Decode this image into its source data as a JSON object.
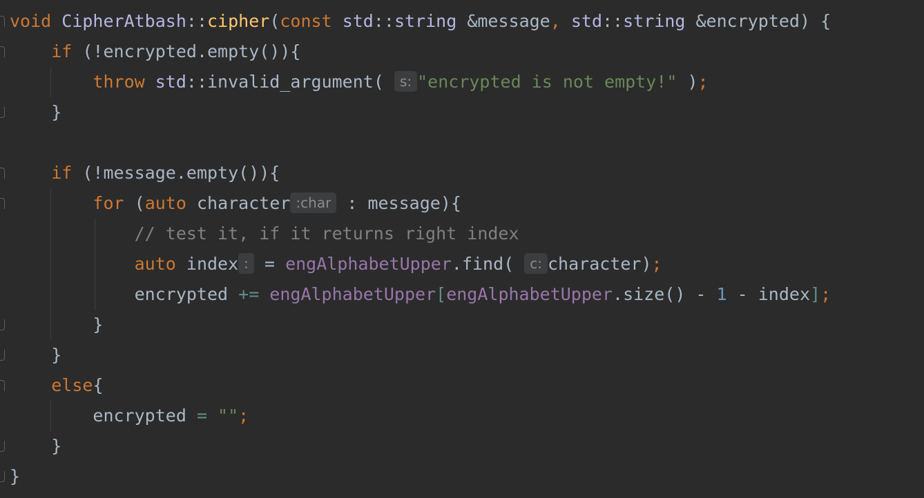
{
  "editor": {
    "language": "C++",
    "lines": [
      {
        "tokens": [
          {
            "t": "void ",
            "c": "kw"
          },
          {
            "t": "CipherAtbash",
            "c": "cls"
          },
          {
            "t": "::",
            "c": "plain"
          },
          {
            "t": "cipher",
            "c": "fn"
          },
          {
            "t": "(",
            "c": "plain"
          },
          {
            "t": "const ",
            "c": "kw"
          },
          {
            "t": "std",
            "c": "cls"
          },
          {
            "t": "::",
            "c": "plain"
          },
          {
            "t": "string ",
            "c": "cls"
          },
          {
            "t": "&message",
            "c": "plain"
          },
          {
            "t": ", ",
            "c": "kw"
          },
          {
            "t": "std",
            "c": "cls"
          },
          {
            "t": "::",
            "c": "plain"
          },
          {
            "t": "string ",
            "c": "cls"
          },
          {
            "t": "&encrypted) {",
            "c": "plain"
          }
        ]
      },
      {
        "tokens": [
          {
            "t": "    ",
            "c": "plain"
          },
          {
            "t": "if ",
            "c": "kw"
          },
          {
            "t": "(!encrypted.empty()){",
            "c": "plain"
          }
        ]
      },
      {
        "tokens": [
          {
            "t": "        ",
            "c": "plain"
          },
          {
            "t": "throw ",
            "c": "kw"
          },
          {
            "t": "std",
            "c": "cls"
          },
          {
            "t": "::",
            "c": "plain"
          },
          {
            "t": "invalid_argument( ",
            "c": "plain"
          },
          {
            "t": "s:",
            "c": "hint"
          },
          {
            "t": "\"encrypted is not empty!\"",
            "c": "str"
          },
          {
            "t": " )",
            "c": "plain"
          },
          {
            "t": ";",
            "c": "kw"
          }
        ]
      },
      {
        "tokens": [
          {
            "t": "    }",
            "c": "plain"
          }
        ]
      },
      {
        "tokens": [
          {
            "t": "",
            "c": "plain"
          }
        ]
      },
      {
        "tokens": [
          {
            "t": "    ",
            "c": "plain"
          },
          {
            "t": "if ",
            "c": "kw"
          },
          {
            "t": "(!message.empty()){",
            "c": "plain"
          }
        ]
      },
      {
        "tokens": [
          {
            "t": "        ",
            "c": "plain"
          },
          {
            "t": "for ",
            "c": "kw"
          },
          {
            "t": "(",
            "c": "plain"
          },
          {
            "t": "auto ",
            "c": "kw"
          },
          {
            "t": "character",
            "c": "plain"
          },
          {
            "t": ":char",
            "c": "hint"
          },
          {
            "t": " : message){",
            "c": "plain"
          }
        ]
      },
      {
        "tokens": [
          {
            "t": "            ",
            "c": "plain"
          },
          {
            "t": "// test it, if it returns right index",
            "c": "cmt"
          }
        ]
      },
      {
        "tokens": [
          {
            "t": "            ",
            "c": "plain"
          },
          {
            "t": "auto ",
            "c": "kw"
          },
          {
            "t": "index",
            "c": "plain"
          },
          {
            "t": ":",
            "c": "hint"
          },
          {
            "t": " = ",
            "c": "plain"
          },
          {
            "t": "engAlphabetUpper",
            "c": "field"
          },
          {
            "t": ".find( ",
            "c": "plain"
          },
          {
            "t": "c:",
            "c": "hint"
          },
          {
            "t": "character)",
            "c": "plain"
          },
          {
            "t": ";",
            "c": "kw"
          }
        ]
      },
      {
        "tokens": [
          {
            "t": "            ",
            "c": "plain"
          },
          {
            "t": "encrypted ",
            "c": "plain"
          },
          {
            "t": "+= ",
            "c": "op"
          },
          {
            "t": "engAlphabetUpper",
            "c": "field"
          },
          {
            "t": "[",
            "c": "op"
          },
          {
            "t": "engAlphabetUpper",
            "c": "field"
          },
          {
            "t": ".size() - ",
            "c": "plain"
          },
          {
            "t": "1",
            "c": "num"
          },
          {
            "t": " - index",
            "c": "plain"
          },
          {
            "t": "]",
            "c": "op"
          },
          {
            "t": ";",
            "c": "kw"
          }
        ]
      },
      {
        "tokens": [
          {
            "t": "        }",
            "c": "plain"
          }
        ]
      },
      {
        "tokens": [
          {
            "t": "    }",
            "c": "plain"
          }
        ]
      },
      {
        "tokens": [
          {
            "t": "    ",
            "c": "plain"
          },
          {
            "t": "else",
            "c": "kw"
          },
          {
            "t": "{",
            "c": "plain"
          }
        ]
      },
      {
        "tokens": [
          {
            "t": "        ",
            "c": "plain"
          },
          {
            "t": "encrypted ",
            "c": "plain"
          },
          {
            "t": "= ",
            "c": "op"
          },
          {
            "t": "\"\"",
            "c": "str"
          },
          {
            "t": ";",
            "c": "kw"
          }
        ]
      },
      {
        "tokens": [
          {
            "t": "    }",
            "c": "plain"
          }
        ]
      },
      {
        "tokens": [
          {
            "t": "}",
            "c": "plain"
          }
        ]
      }
    ]
  },
  "colors": {
    "background": "#2b2b2b",
    "keyword": "#cc7832",
    "class": "#b5b6e3",
    "function": "#ffc66d",
    "field": "#9876aa",
    "string": "#6a8759",
    "number": "#6897bb",
    "comment": "#808080",
    "default": "#a9b7c6"
  }
}
